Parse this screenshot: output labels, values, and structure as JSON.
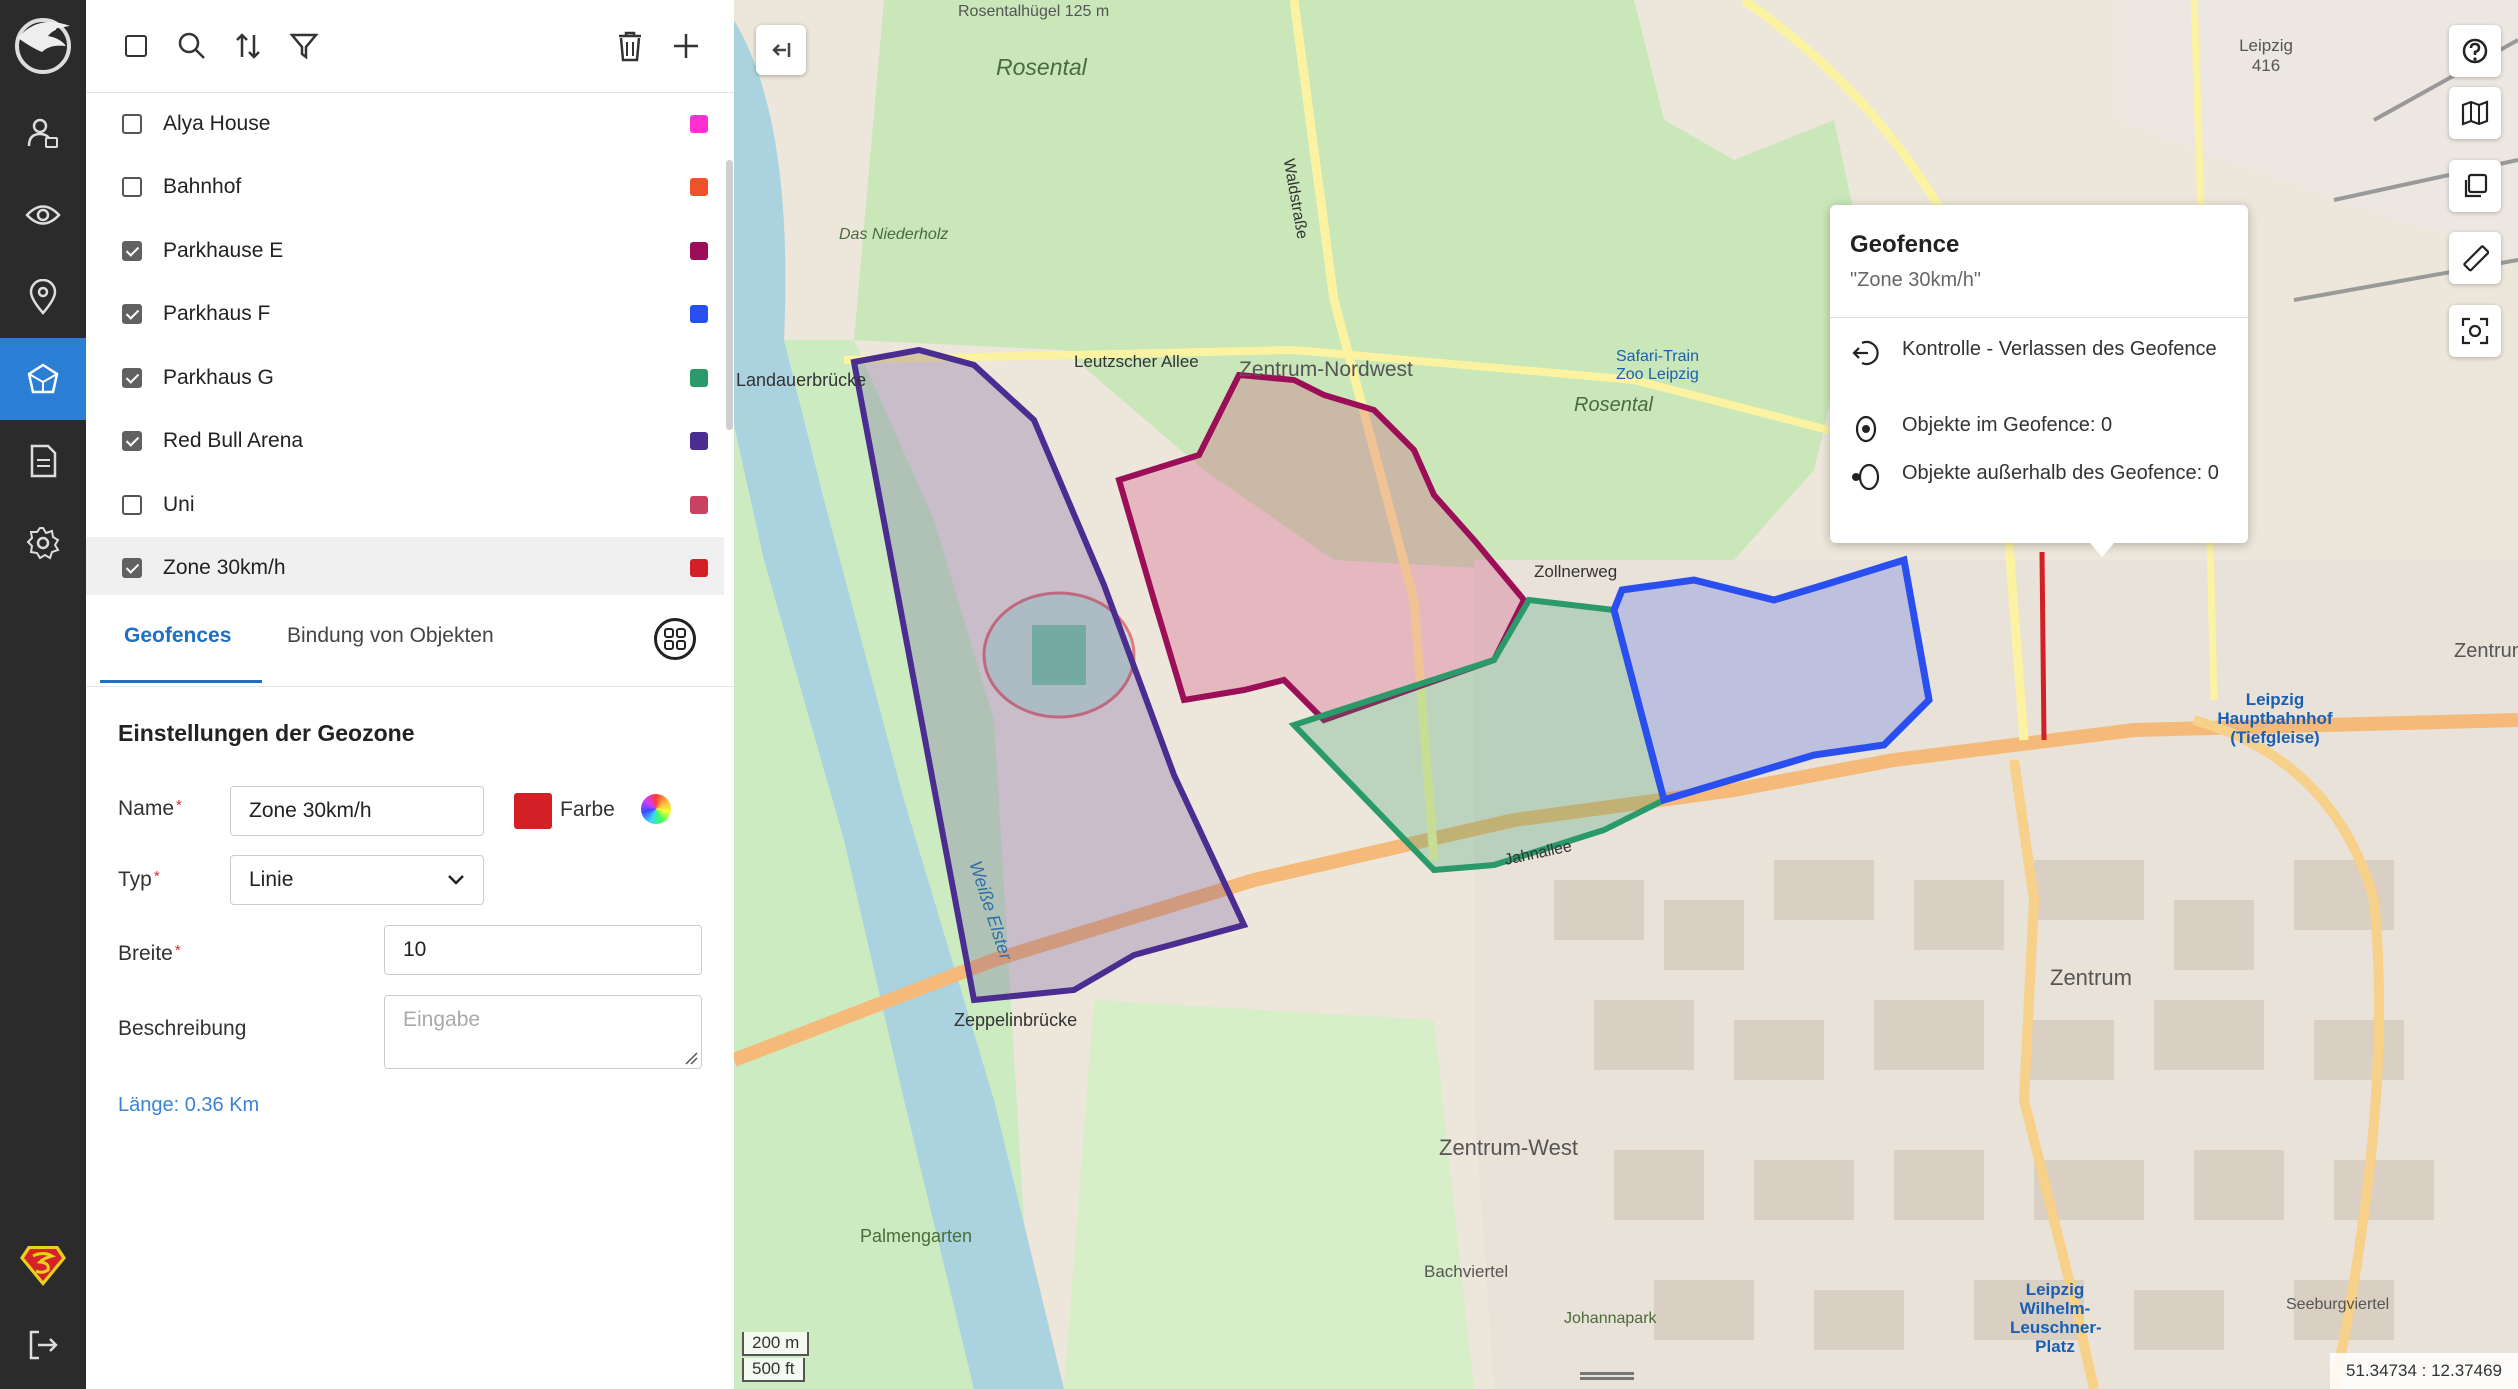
{
  "nav": {
    "items": [
      "profile",
      "visibility",
      "location",
      "geofence",
      "document",
      "settings"
    ],
    "active": "geofence"
  },
  "toolbar": {
    "icons": [
      "select-all",
      "search",
      "sort",
      "filter",
      "delete",
      "add"
    ]
  },
  "geofence_list": [
    {
      "label": "Alya House",
      "checked": false,
      "color": "#ff2fd2"
    },
    {
      "label": "Bahnhof",
      "checked": false,
      "color": "#f0502a"
    },
    {
      "label": "Parkhause E",
      "checked": true,
      "color": "#9c0f58"
    },
    {
      "label": "Parkhaus F",
      "checked": true,
      "color": "#2a4ff0"
    },
    {
      "label": "Parkhaus G",
      "checked": true,
      "color": "#2a9a6a"
    },
    {
      "label": "Red Bull Arena",
      "checked": true,
      "color": "#4b2c91"
    },
    {
      "label": "Uni",
      "checked": false,
      "color": "#c94262"
    },
    {
      "label": "Zone 30km/h",
      "checked": true,
      "color": "#d32027",
      "selected": true
    }
  ],
  "tabs": {
    "geofences": "Geofences",
    "binding": "Bindung von Objekten"
  },
  "form": {
    "section_title": "Einstellungen der Geozone",
    "name_label": "Name",
    "name_value": "Zone 30km/h",
    "color_label": "Farbe",
    "color_value": "#d32027",
    "type_label": "Typ",
    "type_value": "Linie",
    "width_label": "Breite",
    "width_value": "10",
    "desc_label": "Beschreibung",
    "desc_placeholder": "Eingabe",
    "length_text": "Länge: 0.36 Km",
    "required_mark": "*"
  },
  "popup": {
    "title": "Geofence",
    "subtitle": "\"Zone 30km/h\"",
    "rows": [
      "Kontrolle - Verlassen des Geofence",
      "Objekte im Geofence: 0",
      "Objekte außerhalb des Geofence: 0"
    ]
  },
  "map": {
    "labels": {
      "rosental_huegel": "Rosentalhügel 125 m",
      "rosental_top": "Rosental",
      "zentrum_nordwest": "Zentrum-Nordwest",
      "rosental_mid": "Rosental",
      "safari": "Safari-Train Zoo Leipzig",
      "landauerbruecke": "Landauerbrücke",
      "leutzscher_allee": "Leutzscher Allee",
      "waldstrasse": "Waldstraße",
      "zollnerweg": "Zollnerweg",
      "das_niederholz": "Das Niederholz",
      "jahnallee": "Jahnallee",
      "zeppelinbruecke": "Zeppelinbrücke",
      "zentrum_west": "Zentrum-West",
      "zentrum": "Zentrum",
      "hauptbahnhof": "Leipzig Hauptbahnhof (Tiefgleise)",
      "wilhelm_leuschner": "Leipzig Wilhelm-Leuschner-Platz",
      "palmengarten": "Palmengarten",
      "bachviertel": "Bachviertel",
      "weisse_elster": "Weiße Elster",
      "leipzig_416": "Leipzig 416",
      "zentrum_o": "Zentrum-O",
      "seeburgviertel": "Seeburgviertel",
      "johannapark": "Johannapark"
    },
    "scale_m": "200 m",
    "scale_ft": "500 ft",
    "coords": "51.34734 : 12.37469"
  }
}
